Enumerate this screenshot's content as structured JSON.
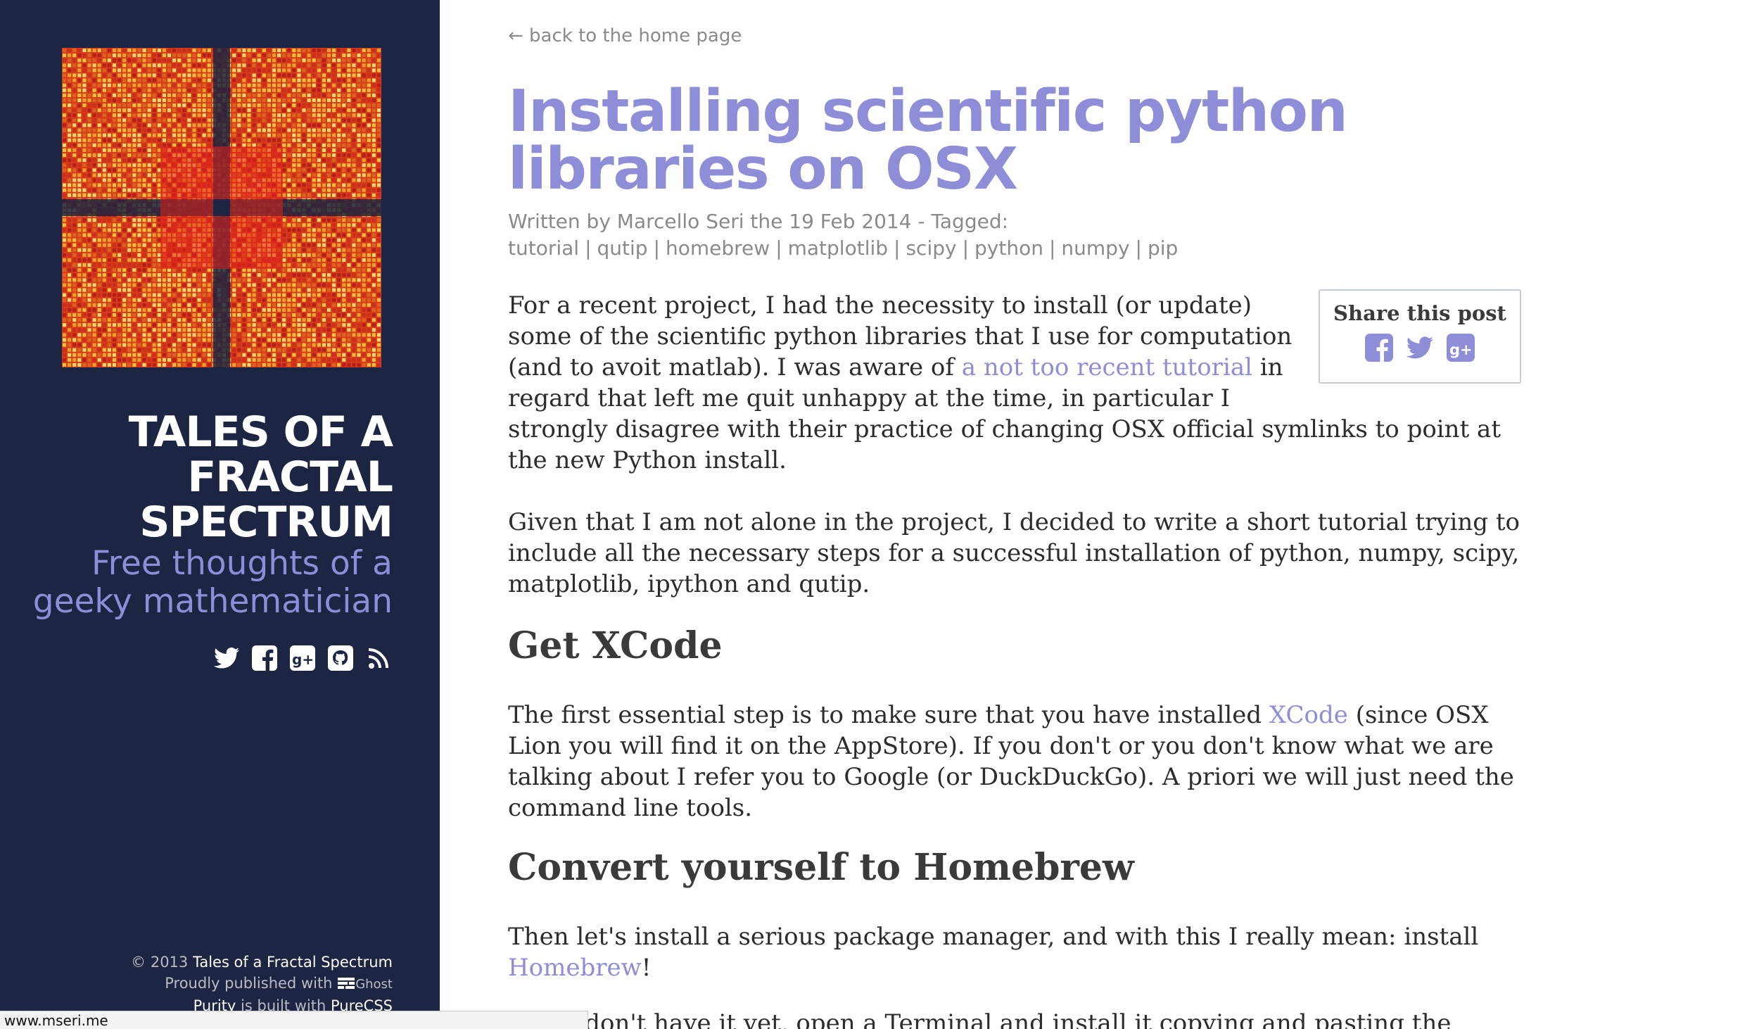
{
  "sidebar": {
    "blog_title": "TALES OF A FRACTAL SPECTRUM",
    "tagline": "Free thoughts of a geeky mathematician",
    "social_icons": [
      "twitter-icon",
      "facebook-icon",
      "google-plus-icon",
      "github-icon",
      "rss-icon"
    ],
    "footer": {
      "copyright_prefix": "© 2013",
      "copyright_site": "Tales of a Fractal Spectrum",
      "published_prefix": "Proudly published with",
      "published_platform": "Ghost",
      "theme_name": "Purity",
      "built_with_text": "is built with",
      "built_with_tool": "PureCSS"
    }
  },
  "status_bar": {
    "url": "www.mseri.me"
  },
  "main": {
    "back_link": "← back to the home page",
    "title": "Installing scientific python libraries on OSX",
    "meta": {
      "prefix": "Written by Marcello Seri the 19 Feb 2014 - Tagged:",
      "tags": [
        "tutorial",
        "qutip",
        "homebrew",
        "matplotlib",
        "scipy",
        "python",
        "numpy",
        "pip"
      ]
    },
    "share": {
      "title": "Share this post",
      "icons": [
        "facebook-icon",
        "twitter-icon",
        "google-plus-icon"
      ]
    },
    "p1": {
      "before": "For a recent project, I had the necessity to install (or update) some of the scientific python libraries that I use for computation (and to avoit matlab). I was aware of ",
      "link": "a not too recent tutorial",
      "after": " in regard that left me quit unhappy at the time, in particular I strongly disagree with their practice of changing OSX official symlinks to point at the new Python install."
    },
    "p2": "Given that I am not alone in the project, I decided to write a short tutorial trying to include all the necessary steps for a successful installation of python, numpy, scipy, matplotlib, ipython and qutip.",
    "heading_xcode": "Get XCode",
    "p3": {
      "before": "The first essential step is to make sure that you have installed ",
      "link": "XCode",
      "after": " (since OSX Lion you will find it on the AppStore). If you don't or you don't know what we are talking about I refer you to Google (or DuckDuckGo). A priori we will just need the command line tools."
    },
    "heading_homebrew": "Convert yourself to Homebrew",
    "p4": {
      "before": "Then let's install a serious package manager, and with this I really mean: install ",
      "link": "Homebrew",
      "after": "!"
    },
    "p5": "If you don't have it yet, open a Terminal and install it copying and pasting the"
  },
  "colors": {
    "sidebar_bg": "#1c2541",
    "accent": "#8d8dd8",
    "meta_gray": "#8a8a8a"
  }
}
